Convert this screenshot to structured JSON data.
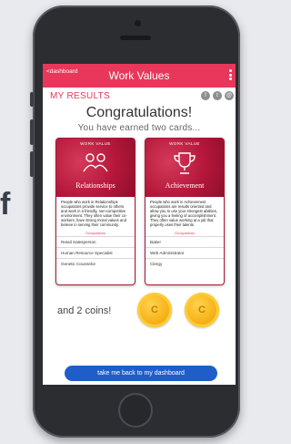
{
  "background": {
    "letter": "f"
  },
  "app": {
    "back_label": "<dashboard",
    "title": "Work Values",
    "accent": "#e8375a"
  },
  "results": {
    "heading": "MY RESULTS",
    "share_icons": [
      "facebook-icon",
      "twitter-icon",
      "email-icon"
    ],
    "congrats": "Congratulations!",
    "earned": "You have earned two cards..."
  },
  "cards": [
    {
      "tag": "WORK VALUE",
      "name": "Relationships",
      "icon": "people-icon",
      "description": "People who work in Relationships occupations provide service to others and work in a friendly, non-competitive environment. They often value their co-workers, have strong moral values and believe in serving their community.",
      "occupations_label": "Occupations",
      "occupations": [
        "Retail Salesperson",
        "Human Resource Specialist",
        "Genetic Counselor"
      ]
    },
    {
      "tag": "WORK VALUE",
      "name": "Achievement",
      "icon": "trophy-icon",
      "description": "People who work in Achievement occupations are results oriented and allow you to use your strongest abilities, giving you a feeling of accomplishment. They often value working at a job that properly uses their talents.",
      "occupations_label": "Occupations",
      "occupations": [
        "Baker",
        "Web Administrator",
        "Clergy"
      ]
    }
  ],
  "coins": {
    "label": "and 2 coins!",
    "coin_text": "C"
  },
  "dashboard_button": "take me back to my dashboard"
}
